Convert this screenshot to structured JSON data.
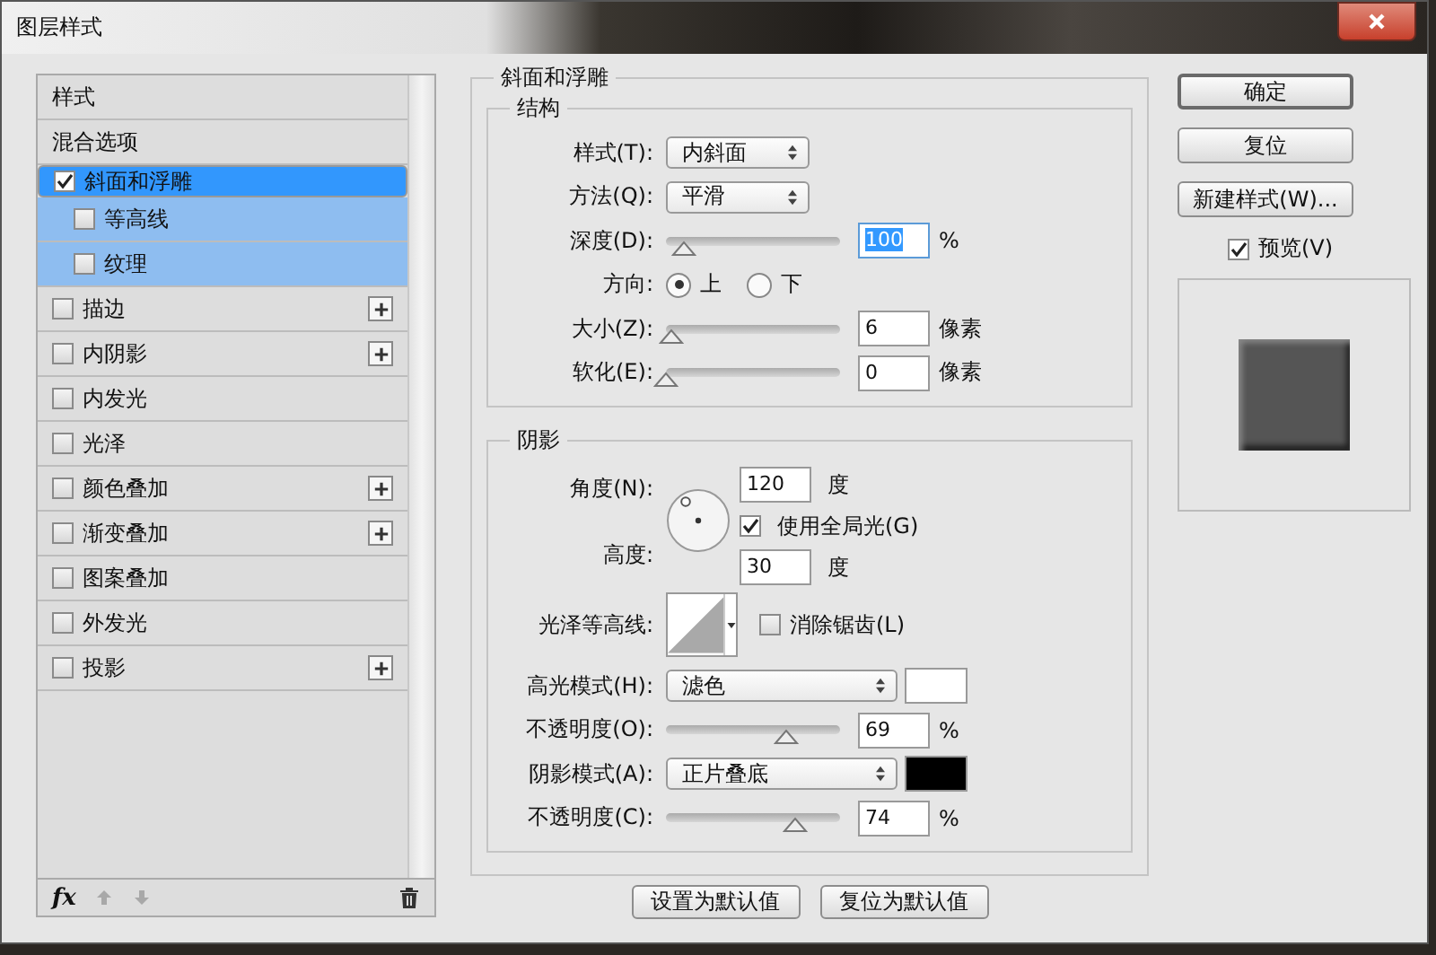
{
  "window": {
    "title": "图层样式"
  },
  "sidebar": {
    "header": "样式",
    "items": [
      {
        "label": "混合选项",
        "kind": "plain",
        "selected": false
      },
      {
        "label": "斜面和浮雕",
        "kind": "checkbox",
        "checked": true,
        "selected": true,
        "addable": false,
        "children": [
          {
            "label": "等高线",
            "kind": "checkbox",
            "checked": false,
            "selected": false,
            "addable": false
          },
          {
            "label": "纹理",
            "kind": "checkbox",
            "checked": false,
            "selected": false,
            "addable": false
          }
        ]
      },
      {
        "label": "描边",
        "kind": "checkbox",
        "checked": false,
        "selected": false,
        "addable": true
      },
      {
        "label": "内阴影",
        "kind": "checkbox",
        "checked": false,
        "selected": false,
        "addable": true
      },
      {
        "label": "内发光",
        "kind": "checkbox",
        "checked": false,
        "selected": false,
        "addable": false
      },
      {
        "label": "光泽",
        "kind": "checkbox",
        "checked": false,
        "selected": false,
        "addable": false
      },
      {
        "label": "颜色叠加",
        "kind": "checkbox",
        "checked": false,
        "selected": false,
        "addable": true
      },
      {
        "label": "渐变叠加",
        "kind": "checkbox",
        "checked": false,
        "selected": false,
        "addable": true
      },
      {
        "label": "图案叠加",
        "kind": "checkbox",
        "checked": false,
        "selected": false,
        "addable": false
      },
      {
        "label": "外发光",
        "kind": "checkbox",
        "checked": false,
        "selected": false,
        "addable": false
      },
      {
        "label": "投影",
        "kind": "checkbox",
        "checked": false,
        "selected": false,
        "addable": true
      }
    ],
    "toolbar": {
      "fx": "fx"
    }
  },
  "panel": {
    "title": "斜面和浮雕",
    "structure": {
      "title": "结构",
      "rows": [
        {
          "kind": "select",
          "label": "样式(T):",
          "value": "内斜面"
        },
        {
          "kind": "select",
          "label": "方法(Q):",
          "value": "平滑"
        },
        {
          "kind": "slider",
          "label": "深度(D):",
          "level": 0.1,
          "value": "100",
          "unit": "%",
          "text_selected": true
        },
        {
          "kind": "radio",
          "label": "方向:",
          "options": [
            {
              "label": "上",
              "selected": true
            },
            {
              "label": "下",
              "selected": false
            }
          ]
        },
        {
          "kind": "slider",
          "label": "大小(Z):",
          "level": 0.03,
          "value": "6",
          "unit": "像素",
          "text_selected": false
        },
        {
          "kind": "slider",
          "label": "软化(E):",
          "level": 0,
          "value": "0",
          "unit": "像素",
          "text_selected": false
        }
      ]
    },
    "shading": {
      "title": "阴影",
      "angle": {
        "label": "角度(N):",
        "value": "120",
        "unit": "度"
      },
      "global_light": {
        "label": "使用全局光(G)",
        "checked": true
      },
      "altitude": {
        "label": "高度:",
        "value": "30",
        "unit": "度"
      },
      "contour": {
        "label": "光泽等高线:"
      },
      "anti_aliased": {
        "label": "消除锯齿(L)",
        "checked": false
      },
      "rows": [
        {
          "kind": "mode",
          "label": "高光模式(H):",
          "value": "滤色",
          "color": "#ffffff"
        },
        {
          "kind": "slider",
          "label": "不透明度(O):",
          "level": 0.69,
          "value": "69",
          "unit": "%",
          "text_selected": false
        },
        {
          "kind": "mode",
          "label": "阴影模式(A):",
          "value": "正片叠底",
          "color": "#000000"
        },
        {
          "kind": "slider",
          "label": "不透明度(C):",
          "level": 0.74,
          "value": "74",
          "unit": "%",
          "text_selected": false
        }
      ]
    },
    "buttons": [
      "设置为默认值",
      "复位为默认值"
    ]
  },
  "actions": [
    {
      "label": "确定",
      "default": true
    },
    {
      "label": "复位",
      "default": false
    },
    {
      "label": "新建样式(W)...",
      "default": false
    }
  ],
  "preview": {
    "label": "预览(V)",
    "checked": true
  }
}
